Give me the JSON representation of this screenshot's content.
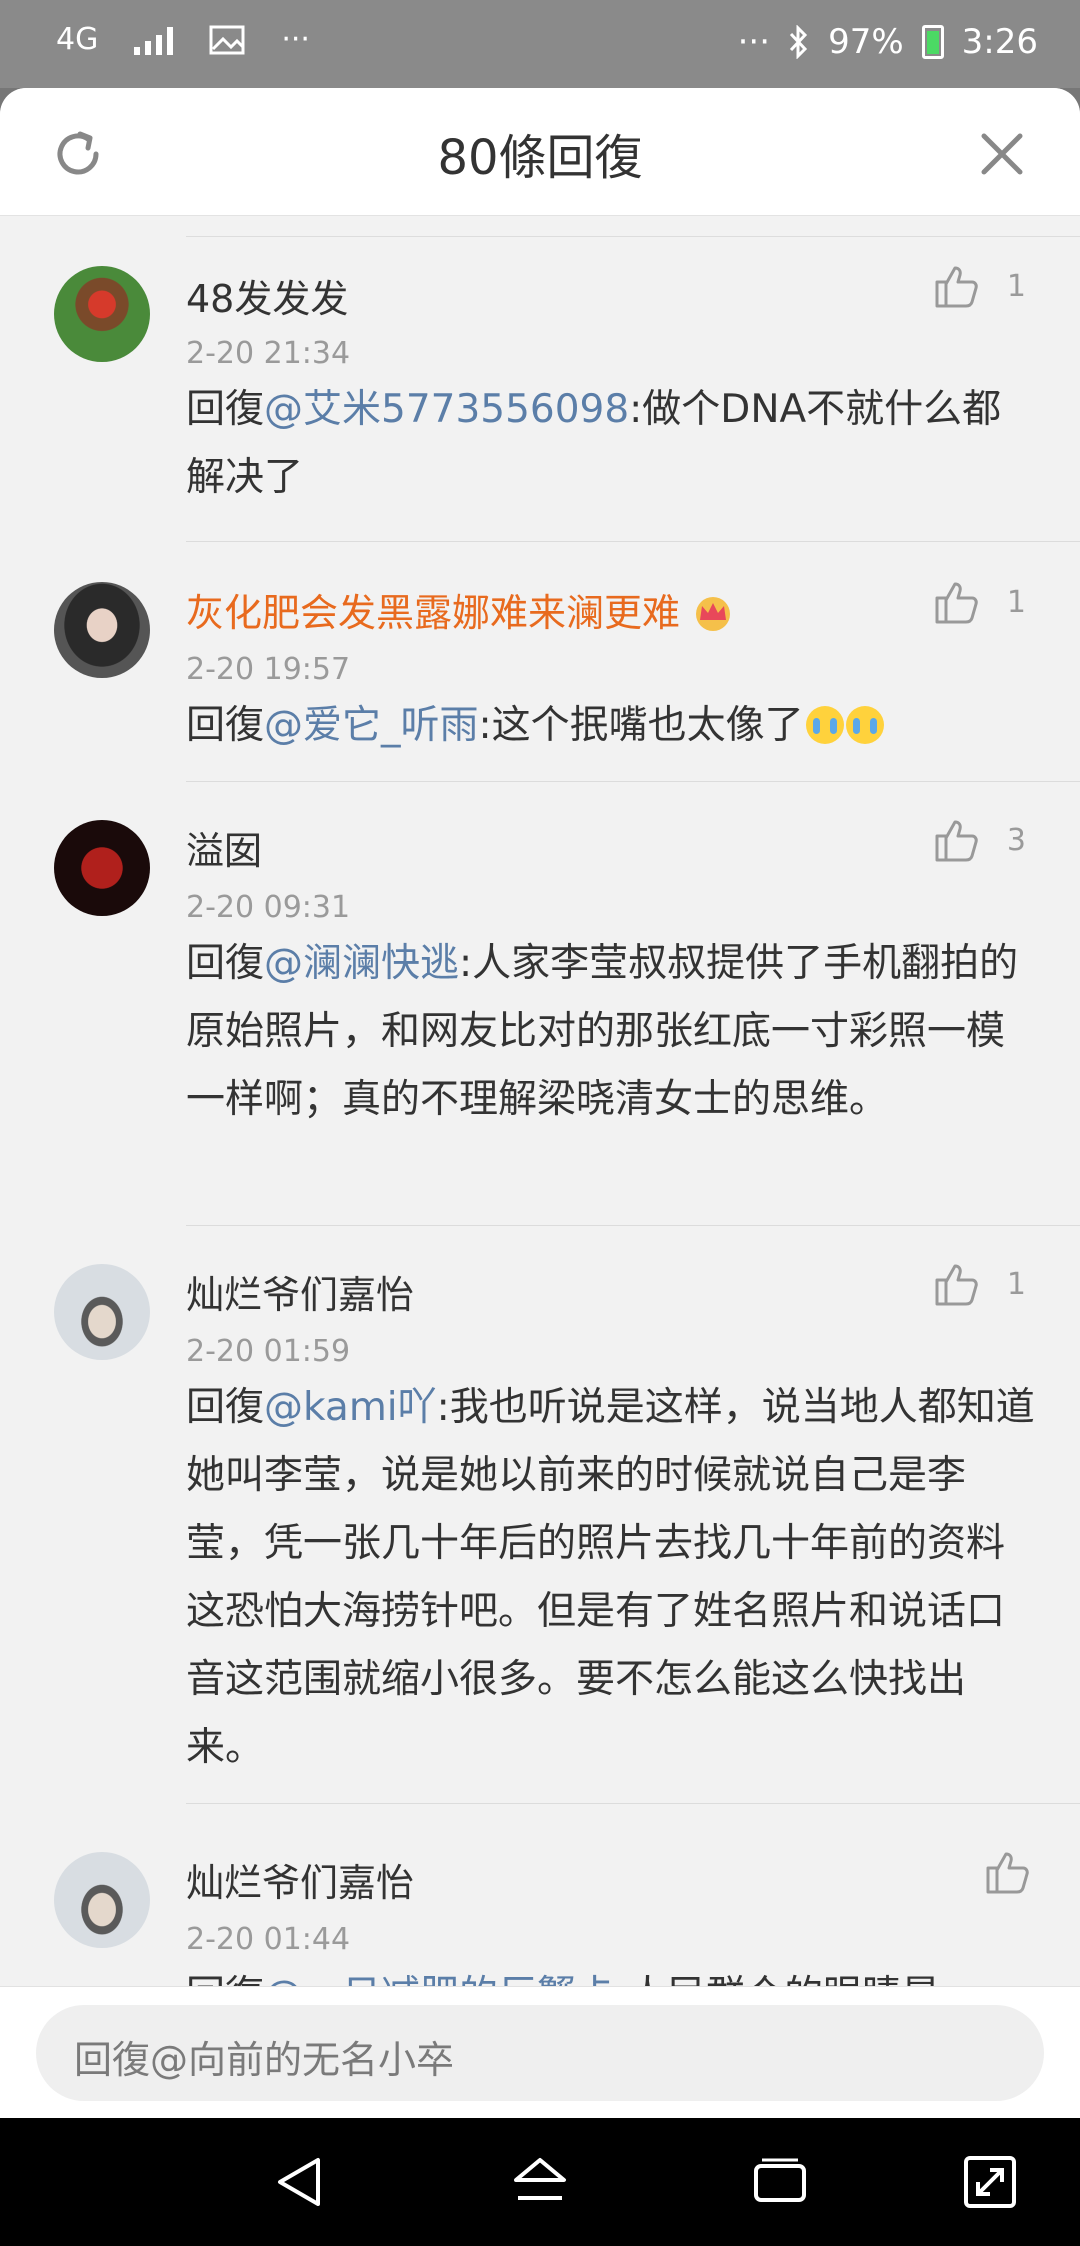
{
  "status_bar": {
    "network": "4G",
    "dots_left": "···",
    "dots_right": "···",
    "battery_percent": "97%",
    "time": "3:26"
  },
  "sheet": {
    "title": "80條回復",
    "refresh_icon": "refresh-icon",
    "close_icon": "close-icon"
  },
  "comments": [
    {
      "name": "48发发发",
      "time": "2-20 21:34",
      "likes": "1",
      "prefix": "回復",
      "mention": "@艾米5773556098",
      "text": ":做个DNA不就什么都解决了"
    },
    {
      "name": "灰化肥会发黑露娜难来澜更难",
      "time": "2-20 19:57",
      "likes": "1",
      "prefix": "回復",
      "mention": "@爱它_听雨",
      "text": ":这个抿嘴也太像了"
    },
    {
      "name": "溢囡",
      "time": "2-20 09:31",
      "likes": "3",
      "prefix": "回復",
      "mention": "@澜澜快逃",
      "text": ":人家李莹叔叔提供了手机翻拍的原始照片，和网友比对的那张红底一寸彩照一模一样啊；真的不理解梁晓清女士的思维。"
    },
    {
      "name": "灿烂爷们嘉怡",
      "time": "2-20 01:59",
      "likes": "1",
      "prefix": "回復",
      "mention": "@kami吖",
      "text": ":我也听说是这样，说当地人都知道她叫李莹，说是她以前来的时候就说自己是李莹，凭一张几十年后的照片去找几十年前的资料这恐怕大海捞针吧。但是有了姓名照片和说话口音这范围就缩小很多。要不怎么能这么快找出来。"
    },
    {
      "name": "灿烂爷们嘉怡",
      "time": "2-20 01:44",
      "likes": "",
      "prefix": "回復",
      "mention": "@一日减肥的巨蟹卡",
      "text": ":人民群众的眼睛是"
    }
  ],
  "input": {
    "placeholder": "回復@向前的无名小卒"
  },
  "nav": {
    "back_icon": "back-triangle-icon",
    "home_icon": "home-icon",
    "recents_icon": "recents-icon",
    "fullscreen_icon": "expand-icon"
  }
}
